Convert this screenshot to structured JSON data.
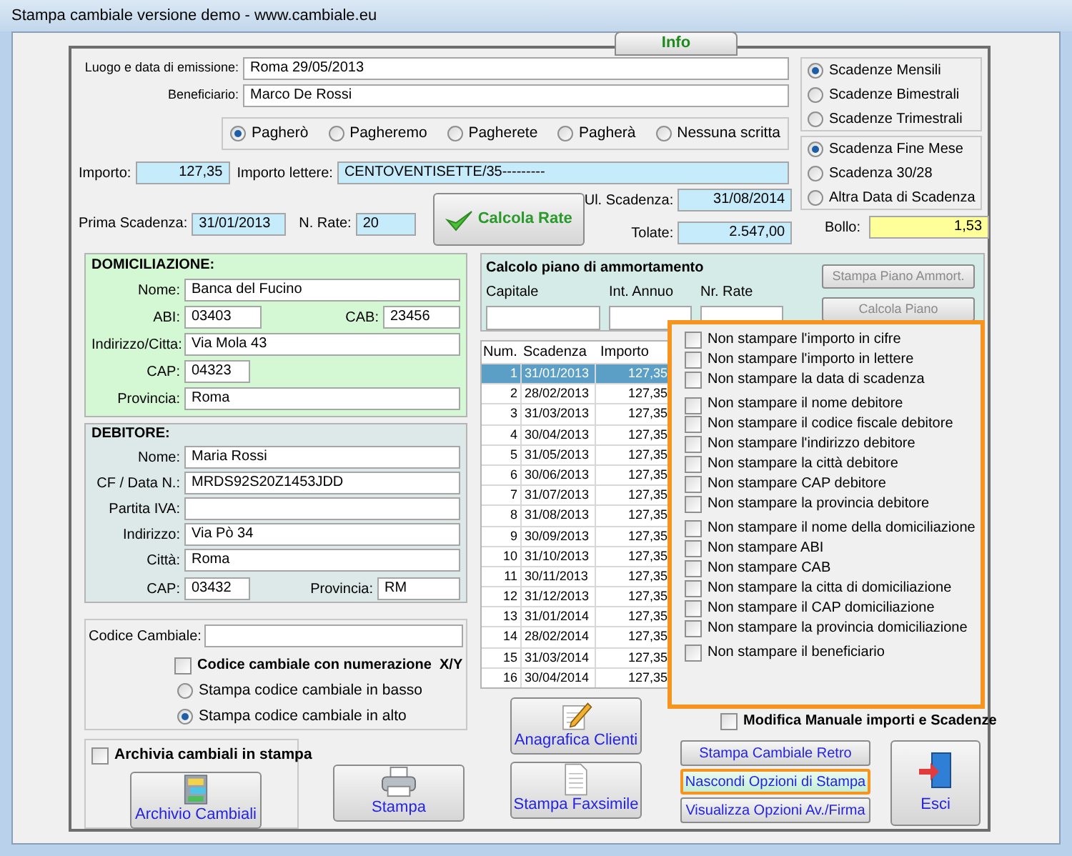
{
  "window": {
    "title": "Stampa cambiale versione demo - www.cambiale.eu"
  },
  "tab": {
    "label": "Info"
  },
  "emissione": {
    "label": "Luogo e data di emissione:",
    "value": "Roma 29/05/2013"
  },
  "beneficiario": {
    "label": "Beneficiario:",
    "value": "Marco De Rossi"
  },
  "payment_words": [
    {
      "label": "Pagherò",
      "selected": true
    },
    {
      "label": "Pagheremo",
      "selected": false
    },
    {
      "label": "Pagherete",
      "selected": false
    },
    {
      "label": "Pagherà",
      "selected": false
    },
    {
      "label": "Nessuna scritta",
      "selected": false
    }
  ],
  "frequency": [
    {
      "label": "Scadenze Mensili",
      "selected": true
    },
    {
      "label": "Scadenze Bimestrali",
      "selected": false
    },
    {
      "label": "Scadenze Trimestrali",
      "selected": false
    }
  ],
  "due_date_rule": [
    {
      "label": "Scadenza Fine Mese",
      "selected": true
    },
    {
      "label": "Scadenza 30/28",
      "selected": false
    },
    {
      "label": "Altra Data di Scadenza",
      "selected": false
    }
  ],
  "importo": {
    "label": "Importo:",
    "value": "127,35"
  },
  "importo_lettere": {
    "label": "Importo lettere:",
    "value": "CENTOVENTISETTE/35---------"
  },
  "prima_scadenza": {
    "label": "Prima Scadenza:",
    "value": "31/01/2013"
  },
  "n_rate": {
    "label": "N. Rate:",
    "value": "20"
  },
  "calcola_rate_button": {
    "label": "Calcola Rate"
  },
  "ultima_scadenza": {
    "label": "Ul. Scadenza:",
    "value": "31/08/2014"
  },
  "totale": {
    "label": "Tolate:",
    "value": "2.547,00"
  },
  "bollo": {
    "label": "Bollo:",
    "value": "1,53"
  },
  "domiciliazione": {
    "title": "DOMICILIAZIONE:",
    "nome": {
      "label": "Nome:",
      "value": "Banca del Fucino"
    },
    "abi": {
      "label": "ABI:",
      "value": "03403"
    },
    "cab": {
      "label": "CAB:",
      "value": "23456"
    },
    "indirizzo": {
      "label": "Indirizzo/Citta:",
      "value": "Via Mola 43"
    },
    "cap": {
      "label": "CAP:",
      "value": "04323"
    },
    "provincia": {
      "label": "Provincia:",
      "value": "Roma"
    }
  },
  "debitore": {
    "title": "DEBITORE:",
    "nome": {
      "label": "Nome:",
      "value": "Maria Rossi"
    },
    "cf": {
      "label": "CF / Data N.:",
      "value": "MRDS92S20Z1453JDD"
    },
    "partita_iva": {
      "label": "Partita IVA:"
    },
    "indirizzo": {
      "label": "Indirizzo:",
      "value": "Via Pò 34"
    },
    "citta": {
      "label": "Città:",
      "value": "Roma"
    },
    "cap": {
      "label": "CAP:",
      "value": "03432"
    },
    "provincia": {
      "label": "Provincia:",
      "value": "RM"
    }
  },
  "codice_cambiale": {
    "label": "Codice Cambiale:"
  },
  "numerazione": {
    "label": "Codice cambiale con numerazione  X/Y",
    "checked": false
  },
  "codice_position": [
    {
      "label": "Stampa codice cambiale in basso",
      "selected": false
    },
    {
      "label": "Stampa codice cambiale in alto",
      "selected": true
    }
  ],
  "archivia": {
    "label": "Archivia cambiali in stampa",
    "checked": false
  },
  "left_buttons": [
    {
      "kind": "archive",
      "label": "Archivio Cambiali"
    },
    {
      "kind": "print",
      "label": "Stampa"
    }
  ],
  "ammortamento": {
    "title": "Calcolo piano di ammortamento",
    "fields": [
      "Capitale",
      "Int. Annuo",
      "Nr. Rate"
    ],
    "buttons": [
      {
        "label": "Stampa Piano Ammort.",
        "disabled": true
      },
      {
        "label": "Calcola Piano",
        "disabled": true
      }
    ]
  },
  "table": {
    "columns": [
      "Num.",
      "Scadenza",
      "Importo"
    ],
    "rows": [
      {
        "cells": [
          "1",
          "31/01/2013",
          "127,35"
        ],
        "selected": true
      },
      {
        "cells": [
          "2",
          "28/02/2013",
          "127,35"
        ],
        "selected": false
      },
      {
        "cells": [
          "3",
          "31/03/2013",
          "127,35"
        ],
        "selected": false
      },
      {
        "cells": [
          "4",
          "30/04/2013",
          "127,35"
        ],
        "selected": false
      },
      {
        "cells": [
          "5",
          "31/05/2013",
          "127,35"
        ],
        "selected": false
      },
      {
        "cells": [
          "6",
          "30/06/2013",
          "127,35"
        ],
        "selected": false
      },
      {
        "cells": [
          "7",
          "31/07/2013",
          "127,35"
        ],
        "selected": false
      },
      {
        "cells": [
          "8",
          "31/08/2013",
          "127,35"
        ],
        "selected": false
      },
      {
        "cells": [
          "9",
          "30/09/2013",
          "127,35"
        ],
        "selected": false
      },
      {
        "cells": [
          "10",
          "31/10/2013",
          "127,35"
        ],
        "selected": false
      },
      {
        "cells": [
          "11",
          "30/11/2013",
          "127,35"
        ],
        "selected": false
      },
      {
        "cells": [
          "12",
          "31/12/2013",
          "127,35"
        ],
        "selected": false
      },
      {
        "cells": [
          "13",
          "31/01/2014",
          "127,35"
        ],
        "selected": false
      },
      {
        "cells": [
          "14",
          "28/02/2014",
          "127,35"
        ],
        "selected": false
      },
      {
        "cells": [
          "15",
          "31/03/2014",
          "127,35"
        ],
        "selected": false
      },
      {
        "cells": [
          "16",
          "30/04/2014",
          "127,35"
        ],
        "selected": false
      }
    ]
  },
  "middle_buttons": [
    {
      "kind": "clients",
      "label": "Anagrafica Clienti"
    },
    {
      "kind": "fax",
      "label": "Stampa Faxsimile"
    }
  ],
  "print_options": {
    "highlighted": true,
    "groups": [
      [
        {
          "label": "Non stampare l'importo in cifre",
          "checked": false
        },
        {
          "label": "Non stampare l'importo in lettere",
          "checked": false
        },
        {
          "label": "Non stampare la data di scadenza",
          "checked": false
        }
      ],
      [
        {
          "label": "Non stampare il nome debitore",
          "checked": false
        },
        {
          "label": "Non stampare il codice fiscale debitore",
          "checked": false
        },
        {
          "label": "Non stampare l'indirizzo debitore",
          "checked": false
        },
        {
          "label": "Non stampare la città debitore",
          "checked": false
        },
        {
          "label": "Non stampare CAP debitore",
          "checked": false
        },
        {
          "label": "Non stampare la provincia debitore",
          "checked": false
        }
      ],
      [
        {
          "label": "Non stampare il nome della domiciliazione",
          "checked": false
        },
        {
          "label": "Non stampare ABI",
          "checked": false
        },
        {
          "label": "Non stampare CAB",
          "checked": false
        },
        {
          "label": "Non stampare la citta di domiciliazione",
          "checked": false
        },
        {
          "label": "Non stampare il CAP domiciliazione",
          "checked": false
        },
        {
          "label": "Non stampare la provincia domiciliazione",
          "checked": false
        }
      ],
      [
        {
          "label": "Non stampare il beneficiario",
          "checked": false
        }
      ]
    ]
  },
  "modifica": {
    "label": "Modifica Manuale importi e Scadenze",
    "checked": false
  },
  "option_buttons": [
    {
      "label": "Stampa Cambiale Retro",
      "highlighted": false
    },
    {
      "label": "Nascondi Opzioni di Stampa",
      "highlighted": true
    },
    {
      "label": "Visualizza Opzioni Av./Firma",
      "highlighted": false
    }
  ],
  "exit_button": {
    "label": "Esci"
  }
}
